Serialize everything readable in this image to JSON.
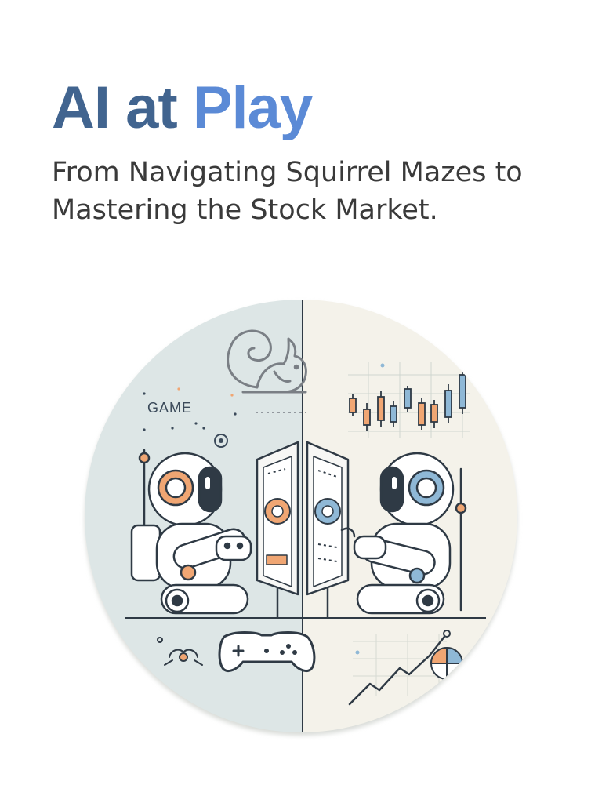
{
  "hero": {
    "title_part1": "AI at",
    "title_part2": "Play",
    "subtitle_line1": "From Navigating Squirrel Mazes to",
    "subtitle_line2": "Mastering the Stock Market."
  },
  "illustration": {
    "game_label": "GAME",
    "left_theme": "game",
    "right_theme": "stock-market",
    "icons": [
      "squirrel-icon",
      "gamepad-icon",
      "candlestick-chart-icon",
      "trend-line-icon",
      "pie-chart-icon"
    ]
  },
  "colors": {
    "title_dark": "#41648f",
    "title_light": "#5b8ad6",
    "subtitle": "#3a3a3a",
    "left_panel": "#dde6e6",
    "right_panel": "#f4f2ea",
    "accent_orange": "#f0a673",
    "accent_blue": "#8fb8d6",
    "line": "#2f3a45"
  }
}
